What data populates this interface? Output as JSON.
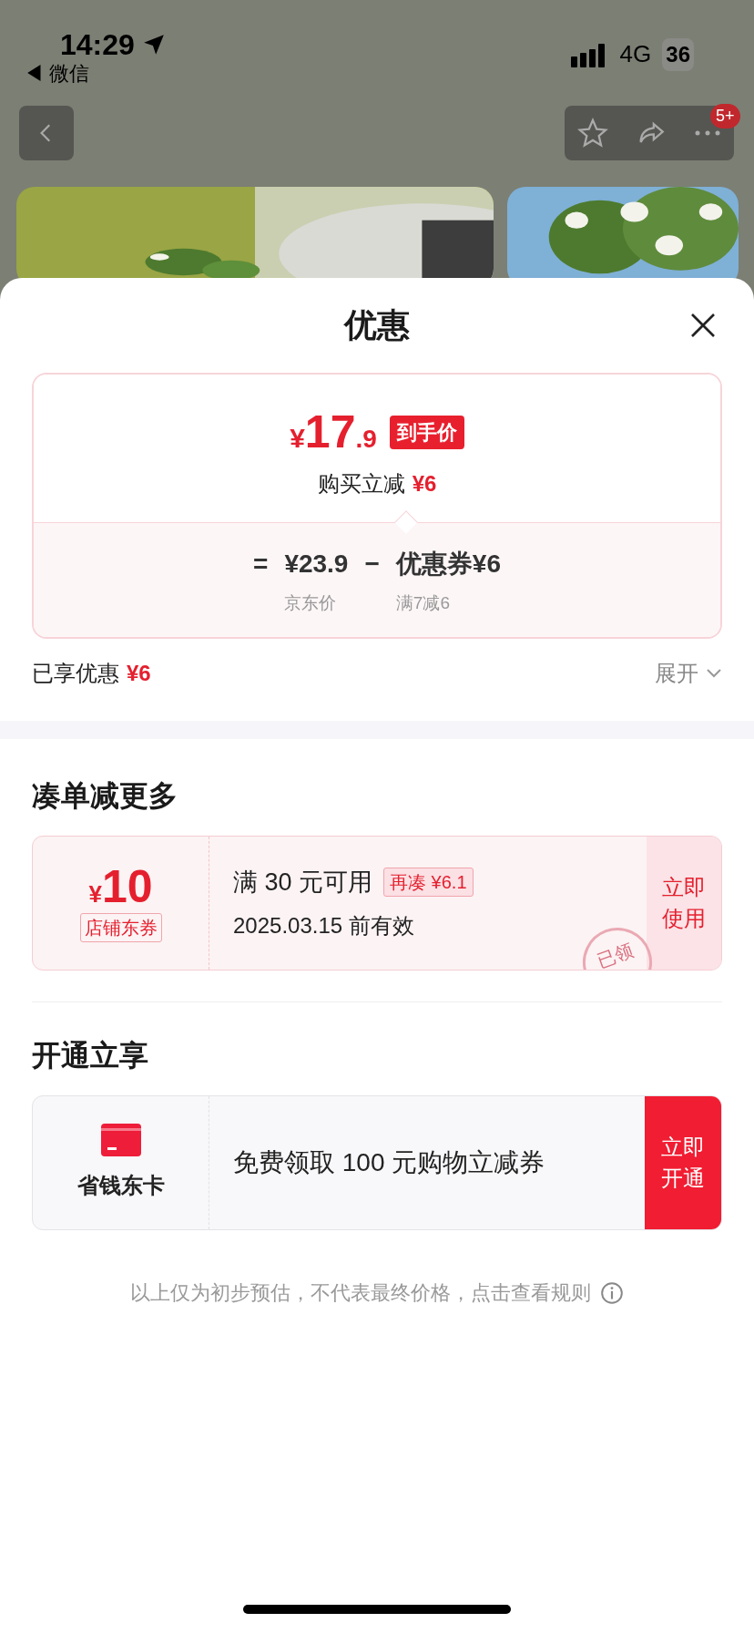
{
  "status_bar": {
    "time": "14:29",
    "back_app": "◀ 微信",
    "network": "4G",
    "battery": "36"
  },
  "nav": {
    "badge": "5+"
  },
  "sheet": {
    "title": "优惠",
    "price_card": {
      "currency": "¥",
      "price_int": "17",
      "price_dec": ".9",
      "price_tag": "到手价",
      "reduce_label": "购买立减",
      "reduce_value": "¥6",
      "formula": [
        {
          "kind": "op",
          "text": "="
        },
        {
          "kind": "term",
          "text": "¥23.9",
          "note": "京东价"
        },
        {
          "kind": "op",
          "text": "−"
        },
        {
          "kind": "term",
          "text": "优惠券¥6",
          "note": "满7减6"
        }
      ]
    },
    "enjoyed": {
      "label": "已享优惠",
      "value": "¥6",
      "expand": "展开",
      "expanded": false
    },
    "more_section": {
      "title": "凑单减更多",
      "coupon": {
        "currency": "¥",
        "amount": "10",
        "type": "店铺东券",
        "condition": "满 30 元可用",
        "extra": "再凑 ¥6.1",
        "validity": "2025.03.15 前有效",
        "action": "立即使用",
        "claimed": true,
        "stamp": "已领"
      }
    },
    "member_section": {
      "title": "开通立享",
      "card": {
        "name": "省钱东卡",
        "offer": "免费领取 100 元购物立减券",
        "action": "立即开通"
      }
    },
    "disclaimer": "以上仅为初步预估，不代表最终价格，点击查看规则"
  }
}
